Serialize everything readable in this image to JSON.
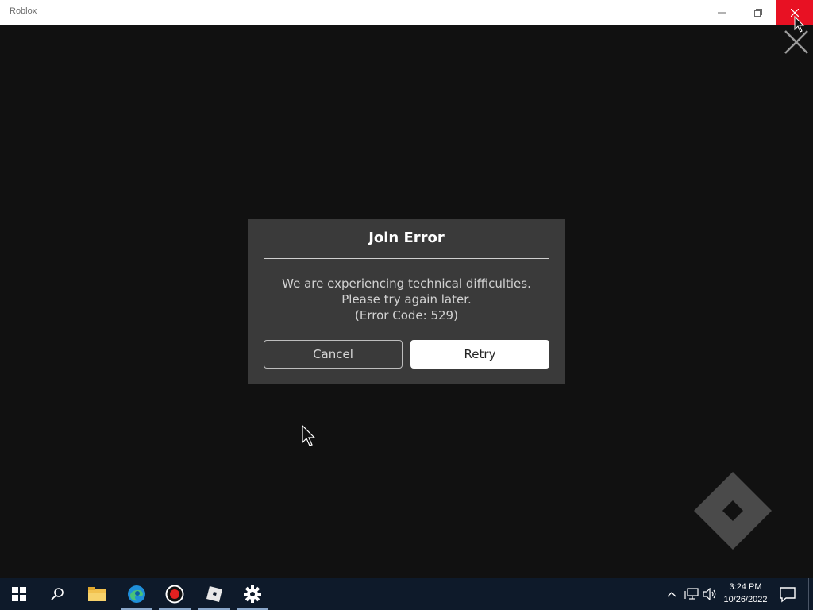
{
  "window": {
    "title": "Roblox"
  },
  "dialog": {
    "title": "Join Error",
    "message": "We are experiencing technical difficulties. Please try again later.",
    "error_code": "(Error Code: 529)",
    "cancel_label": "Cancel",
    "retry_label": "Retry"
  },
  "taskbar": {
    "items": [
      {
        "icon": "windows-start-icon"
      },
      {
        "icon": "search-icon"
      },
      {
        "icon": "file-explorer-icon"
      },
      {
        "icon": "edge-icon"
      },
      {
        "icon": "record-icon"
      },
      {
        "icon": "roblox-icon"
      },
      {
        "icon": "settings-gear-icon"
      }
    ],
    "clock_time": "3:24 PM",
    "clock_date": "10/26/2022"
  },
  "colors": {
    "titlebar_close": "#e81123",
    "dialog_bg": "#3a3a3a",
    "taskbar_bg": "#0e1a2a",
    "viewport_bg": "#111111"
  }
}
